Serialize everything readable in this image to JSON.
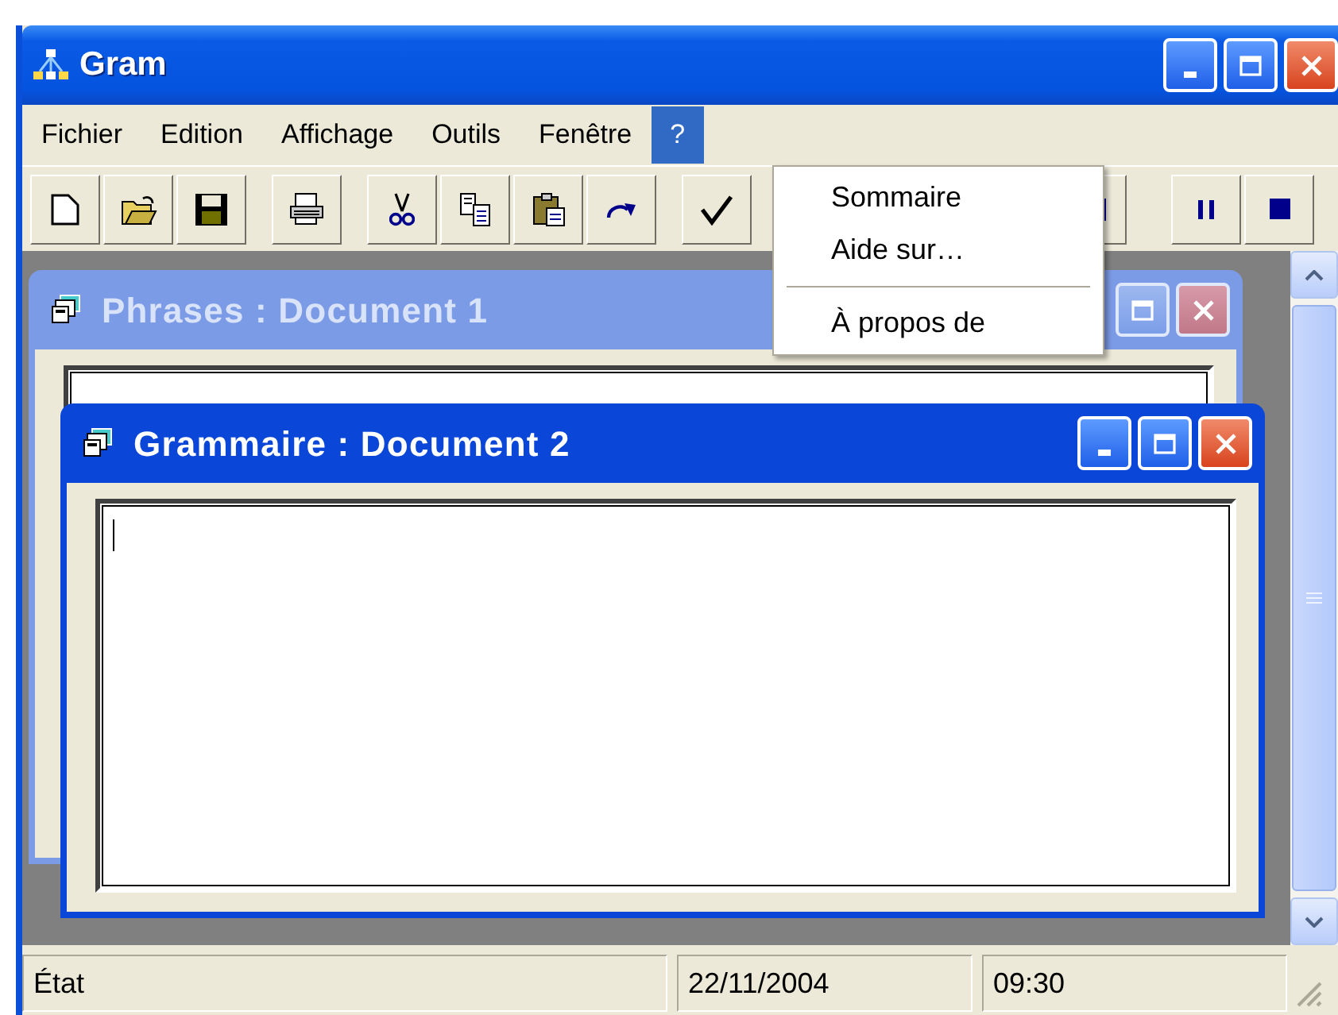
{
  "window": {
    "title": "Gram"
  },
  "menu": [
    {
      "label": "Fichier",
      "selected": false
    },
    {
      "label": "Edition",
      "selected": false
    },
    {
      "label": "Affichage",
      "selected": false
    },
    {
      "label": "Outils",
      "selected": false
    },
    {
      "label": "Fenêtre",
      "selected": false
    },
    {
      "label": "?",
      "selected": true
    }
  ],
  "dropdown": [
    {
      "kind": "item",
      "label": "Sommaire"
    },
    {
      "kind": "item",
      "label": "Aide sur…"
    },
    {
      "kind": "separator"
    },
    {
      "kind": "item",
      "label": "À propos de"
    }
  ],
  "documents": [
    {
      "title": "Phrases : Document 1",
      "active": false
    },
    {
      "title": "Grammaire : Document 2",
      "active": true,
      "caret_visible": true
    }
  ],
  "status_bar": [
    "État",
    "22/11/2004",
    "09:30"
  ]
}
